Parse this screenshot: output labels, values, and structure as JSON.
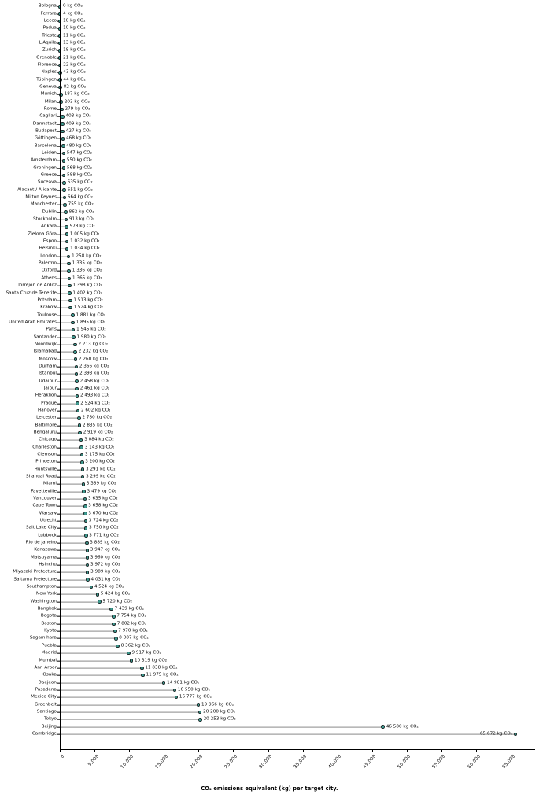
{
  "chart_data": {
    "type": "bar",
    "orientation": "horizontal",
    "title": "",
    "xlabel": "CO₂ emissions equivalent (kg) per target city.",
    "ylabel": "",
    "xlim": [
      0,
      68500
    ],
    "xticks": [
      0,
      5000,
      10000,
      15000,
      20000,
      25000,
      30000,
      35000,
      40000,
      45000,
      50000,
      55000,
      60000,
      65000
    ],
    "xtick_labels": [
      "0",
      "5,000",
      "10,000",
      "15,000",
      "20,000",
      "25,000",
      "30,000",
      "35,000",
      "40,000",
      "45,000",
      "50,000",
      "55,000",
      "60,000",
      "65,000"
    ],
    "grid": false,
    "legend": null,
    "unit_suffix": "kg CO₂",
    "marker_color": "#3e9e93",
    "marker_edge_color": "#1c2a2a",
    "stem_color": "#8a8a8a",
    "categories": [
      "Bologna",
      "Ferrara",
      "Lecco",
      "Padua",
      "Trieste",
      "L'Aquila",
      "Zurich",
      "Grenoble",
      "Florence",
      "Naples",
      "Tübingen",
      "Geneva",
      "Munich",
      "Milan",
      "Rome",
      "Cagliari",
      "Darmstadt",
      "Budapest",
      "Göttingen",
      "Barcelona",
      "Leiden",
      "Amsterdam",
      "Groningen",
      "Greece",
      "Suceava",
      "Alacant / Alicante",
      "Milton Keynes",
      "Manchester",
      "Dublin",
      "Stockholm",
      "Ankara",
      "Zielona Góra",
      "Espoo",
      "Helsinki",
      "London",
      "Palermo",
      "Oxford",
      "Athens",
      "Torrejón de Ardoz",
      "Santa Cruz de Tenerife",
      "Potsdam",
      "Krakow",
      "Toulouse",
      "United Arab Emirates",
      "Paris",
      "Santander",
      "Noordwijk",
      "Islamabad",
      "Moscow",
      "Durham",
      "Istanbul",
      "Udaipur",
      "Jaipur",
      "Heraklion",
      "Prague",
      "Hanover",
      "Leicester",
      "Baltimore",
      "Bengaluru",
      "Chicago",
      "Charleston",
      "Clemson",
      "Princeton",
      "Huntsville",
      "Shangai Road",
      "Miami",
      "Fayetteville",
      "Vancouver",
      "Cape Town",
      "Warsaw",
      "Utrecht",
      "Salt Lake City",
      "Lubbock",
      "Rio de Janeiro",
      "Kanazawa",
      "Matsuyama",
      "Hsinchu",
      "Miyazaki Prefecture",
      "Saitama Prefecture",
      "Southampton",
      "New York",
      "Washington",
      "Bangkok",
      "Bogota",
      "Boston",
      "Kyoto",
      "Sagamihara",
      "Puebla",
      "Madrid",
      "Mumbai",
      "Ann Arbor",
      "Osaka",
      "Daejeon",
      "Pasadena",
      "Mexico City",
      "Greenbelt",
      "Santiago",
      "Tokyo",
      "Beijing",
      "Cambridge"
    ],
    "values": [
      0,
      4,
      10,
      10,
      11,
      13,
      18,
      21,
      22,
      43,
      44,
      82,
      187,
      203,
      279,
      403,
      409,
      427,
      468,
      480,
      547,
      550,
      568,
      588,
      635,
      651,
      664,
      755,
      862,
      913,
      978,
      1005,
      1032,
      1034,
      1258,
      1335,
      1336,
      1365,
      1398,
      1402,
      1513,
      1524,
      1881,
      1895,
      1945,
      1980,
      2213,
      2232,
      2260,
      2366,
      2393,
      2458,
      2461,
      2493,
      2524,
      2602,
      2780,
      2835,
      2919,
      3084,
      3143,
      3175,
      3200,
      3291,
      3299,
      3389,
      3479,
      3635,
      3658,
      3670,
      3724,
      3750,
      3771,
      3889,
      3947,
      3960,
      3972,
      3989,
      4031,
      4524,
      5424,
      5720,
      7439,
      7754,
      7802,
      7970,
      8087,
      8362,
      9917,
      10319,
      11838,
      11975,
      14981,
      16550,
      16777,
      19966,
      20200,
      20253,
      46580,
      65672
    ],
    "value_labels": [
      "0 kg CO₂",
      "4 kg CO₂",
      "10 kg CO₂",
      "10 kg CO₂",
      "11 kg CO₂",
      "13 kg CO₂",
      "18 kg CO₂",
      "21 kg CO₂",
      "22 kg CO₂",
      "43 kg CO₂",
      "44 kg CO₂",
      "82 kg CO₂",
      "187 kg CO₂",
      "203 kg CO₂",
      "279 kg CO₂",
      "403 kg CO₂",
      "409 kg CO₂",
      "427 kg CO₂",
      "468 kg CO₂",
      "480 kg CO₂",
      "547 kg CO₂",
      "550 kg CO₂",
      "568 kg CO₂",
      "588 kg CO₂",
      "635 kg CO₂",
      "651 kg CO₂",
      "664 kg CO₂",
      "755 kg CO₂",
      "862 kg CO₂",
      "913 kg CO₂",
      "978 kg CO₂",
      "1 005 kg CO₂",
      "1 032 kg CO₂",
      "1 034 kg CO₂",
      "1 258 kg CO₂",
      "1 335 kg CO₂",
      "1 336 kg CO₂",
      "1 365 kg CO₂",
      "1 398 kg CO₂",
      "1 402 kg CO₂",
      "1 513 kg CO₂",
      "1 524 kg CO₂",
      "1 881 kg CO₂",
      "1 895 kg CO₂",
      "1 945 kg CO₂",
      "1 980 kg CO₂",
      "2 213 kg CO₂",
      "2 232 kg CO₂",
      "2 260 kg CO₂",
      "2 366 kg CO₂",
      "2 393 kg CO₂",
      "2 458 kg CO₂",
      "2 461 kg CO₂",
      "2 493 kg CO₂",
      "2 524 kg CO₂",
      "2 602 kg CO₂",
      "2 780 kg CO₂",
      "2 835 kg CO₂",
      "2 919 kg CO₂",
      "3 084 kg CO₂",
      "3 143 kg CO₂",
      "3 175 kg CO₂",
      "3 200 kg CO₂",
      "3 291 kg CO₂",
      "3 299 kg CO₂",
      "3 389 kg CO₂",
      "3 479 kg CO₂",
      "3 635 kg CO₂",
      "3 658 kg CO₂",
      "3 670 kg CO₂",
      "3 724 kg CO₂",
      "3 750 kg CO₂",
      "3 771 kg CO₂",
      "3 889 kg CO₂",
      "3 947 kg CO₂",
      "3 960 kg CO₂",
      "3 972 kg CO₂",
      "3 989 kg CO₂",
      "4 031 kg CO₂",
      "4 524 kg CO₂",
      "5 424 kg CO₂",
      "5 720 kg CO₂",
      "7 439 kg CO₂",
      "7 754 kg CO₂",
      "7 802 kg CO₂",
      "7 970 kg CO₂",
      "8 087 kg CO₂",
      "8 362 kg CO₂",
      "9 917 kg CO₂",
      "10 319 kg CO₂",
      "11 838 kg CO₂",
      "11 975 kg CO₂",
      "14 981 kg CO₂",
      "16 550 kg CO₂",
      "16 777 kg CO₂",
      "19 966 kg CO₂",
      "20 200 kg CO₂",
      "20 253 kg CO₂",
      "46 580 kg CO₂",
      "65 672 kg CO₂"
    ]
  }
}
